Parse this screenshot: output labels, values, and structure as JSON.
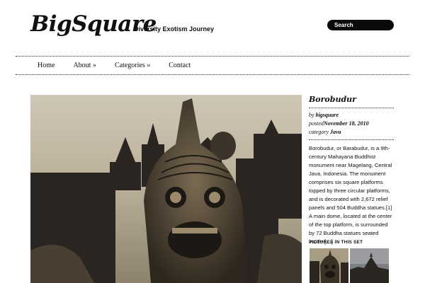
{
  "site": {
    "logo": "BigSquare",
    "tagline": "Diversity Exotism Journey"
  },
  "search": {
    "placeholder": "Search"
  },
  "nav": {
    "items": [
      "Home",
      "About »",
      "Categories »",
      "Contact"
    ]
  },
  "post": {
    "title": "Borobudur",
    "by_label": "by",
    "author": "bigsquare",
    "posted_label": "posted",
    "date": "November 18, 2010",
    "category_label": "category",
    "category": "Java",
    "excerpt": "Borobudur, or Barabudur, is a 9th-century Mahayana Buddhist monument near Magelang, Central Java, Indonesia. The monument comprises six square platforms topped by three circular platforms, and is decorated with 2,672 relief panels and 504 Buddha statues.[1] A main dome, located at the center of the top platform, is surrounded by 72 Buddha statues seated inside […]"
  },
  "gallery": {
    "title": "PICTURES IN THIS SET"
  }
}
